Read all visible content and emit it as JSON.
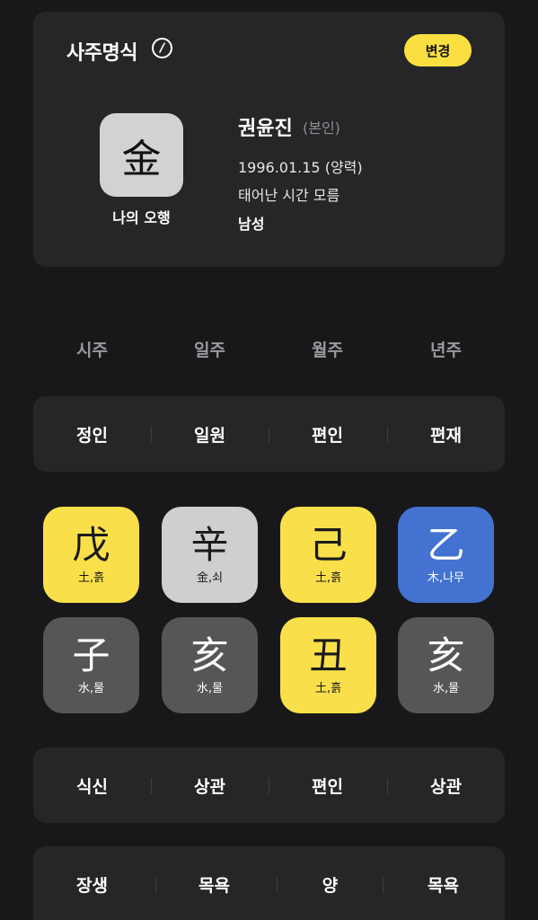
{
  "profile": {
    "title": "사주명식",
    "change_label": "변경",
    "element_char": "金",
    "element_label": "나의 오행",
    "name": "권윤진",
    "tag": "(본인)",
    "birth": "1996.01.15 (양력)",
    "birth_time": "태어난 시간 모름",
    "gender": "남성"
  },
  "columns": [
    "시주",
    "일주",
    "월주",
    "년주"
  ],
  "heaven_ten_gods": [
    "정인",
    "일원",
    "편인",
    "편재"
  ],
  "stems": [
    {
      "char": "戊",
      "sub": "土,흙",
      "color": "yellow"
    },
    {
      "char": "辛",
      "sub": "金,쇠",
      "color": "grey"
    },
    {
      "char": "己",
      "sub": "土,흙",
      "color": "yellow"
    },
    {
      "char": "乙",
      "sub": "木,나무",
      "color": "blue"
    }
  ],
  "branches": [
    {
      "char": "子",
      "sub": "水,물",
      "color": "dark"
    },
    {
      "char": "亥",
      "sub": "水,물",
      "color": "dark"
    },
    {
      "char": "丑",
      "sub": "土,흙",
      "color": "yellow"
    },
    {
      "char": "亥",
      "sub": "水,물",
      "color": "dark"
    }
  ],
  "earth_ten_gods": [
    "식신",
    "상관",
    "편인",
    "상관"
  ],
  "twelve_stages": [
    "장생",
    "목욕",
    "양",
    "목욕"
  ],
  "colors": {
    "background": "#18181a",
    "card": "#262628",
    "accent_yellow": "#f9e04b",
    "metal_grey": "#cfcfcf",
    "wood_blue": "#4372d0",
    "water_dark": "#565658"
  }
}
